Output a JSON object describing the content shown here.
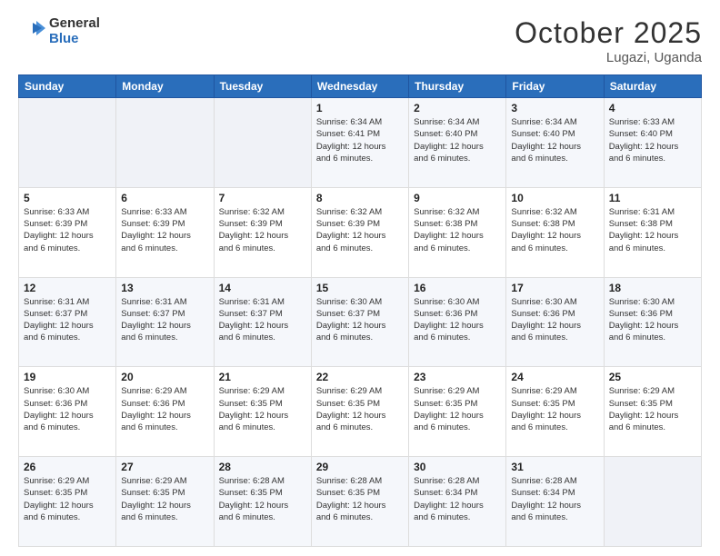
{
  "logo": {
    "line1": "General",
    "line2": "Blue"
  },
  "header": {
    "month": "October 2025",
    "location": "Lugazi, Uganda"
  },
  "weekdays": [
    "Sunday",
    "Monday",
    "Tuesday",
    "Wednesday",
    "Thursday",
    "Friday",
    "Saturday"
  ],
  "weeks": [
    [
      {
        "day": "",
        "info": ""
      },
      {
        "day": "",
        "info": ""
      },
      {
        "day": "",
        "info": ""
      },
      {
        "day": "1",
        "info": "Sunrise: 6:34 AM\nSunset: 6:41 PM\nDaylight: 12 hours\nand 6 minutes."
      },
      {
        "day": "2",
        "info": "Sunrise: 6:34 AM\nSunset: 6:40 PM\nDaylight: 12 hours\nand 6 minutes."
      },
      {
        "day": "3",
        "info": "Sunrise: 6:34 AM\nSunset: 6:40 PM\nDaylight: 12 hours\nand 6 minutes."
      },
      {
        "day": "4",
        "info": "Sunrise: 6:33 AM\nSunset: 6:40 PM\nDaylight: 12 hours\nand 6 minutes."
      }
    ],
    [
      {
        "day": "5",
        "info": "Sunrise: 6:33 AM\nSunset: 6:39 PM\nDaylight: 12 hours\nand 6 minutes."
      },
      {
        "day": "6",
        "info": "Sunrise: 6:33 AM\nSunset: 6:39 PM\nDaylight: 12 hours\nand 6 minutes."
      },
      {
        "day": "7",
        "info": "Sunrise: 6:32 AM\nSunset: 6:39 PM\nDaylight: 12 hours\nand 6 minutes."
      },
      {
        "day": "8",
        "info": "Sunrise: 6:32 AM\nSunset: 6:39 PM\nDaylight: 12 hours\nand 6 minutes."
      },
      {
        "day": "9",
        "info": "Sunrise: 6:32 AM\nSunset: 6:38 PM\nDaylight: 12 hours\nand 6 minutes."
      },
      {
        "day": "10",
        "info": "Sunrise: 6:32 AM\nSunset: 6:38 PM\nDaylight: 12 hours\nand 6 minutes."
      },
      {
        "day": "11",
        "info": "Sunrise: 6:31 AM\nSunset: 6:38 PM\nDaylight: 12 hours\nand 6 minutes."
      }
    ],
    [
      {
        "day": "12",
        "info": "Sunrise: 6:31 AM\nSunset: 6:37 PM\nDaylight: 12 hours\nand 6 minutes."
      },
      {
        "day": "13",
        "info": "Sunrise: 6:31 AM\nSunset: 6:37 PM\nDaylight: 12 hours\nand 6 minutes."
      },
      {
        "day": "14",
        "info": "Sunrise: 6:31 AM\nSunset: 6:37 PM\nDaylight: 12 hours\nand 6 minutes."
      },
      {
        "day": "15",
        "info": "Sunrise: 6:30 AM\nSunset: 6:37 PM\nDaylight: 12 hours\nand 6 minutes."
      },
      {
        "day": "16",
        "info": "Sunrise: 6:30 AM\nSunset: 6:36 PM\nDaylight: 12 hours\nand 6 minutes."
      },
      {
        "day": "17",
        "info": "Sunrise: 6:30 AM\nSunset: 6:36 PM\nDaylight: 12 hours\nand 6 minutes."
      },
      {
        "day": "18",
        "info": "Sunrise: 6:30 AM\nSunset: 6:36 PM\nDaylight: 12 hours\nand 6 minutes."
      }
    ],
    [
      {
        "day": "19",
        "info": "Sunrise: 6:30 AM\nSunset: 6:36 PM\nDaylight: 12 hours\nand 6 minutes."
      },
      {
        "day": "20",
        "info": "Sunrise: 6:29 AM\nSunset: 6:36 PM\nDaylight: 12 hours\nand 6 minutes."
      },
      {
        "day": "21",
        "info": "Sunrise: 6:29 AM\nSunset: 6:35 PM\nDaylight: 12 hours\nand 6 minutes."
      },
      {
        "day": "22",
        "info": "Sunrise: 6:29 AM\nSunset: 6:35 PM\nDaylight: 12 hours\nand 6 minutes."
      },
      {
        "day": "23",
        "info": "Sunrise: 6:29 AM\nSunset: 6:35 PM\nDaylight: 12 hours\nand 6 minutes."
      },
      {
        "day": "24",
        "info": "Sunrise: 6:29 AM\nSunset: 6:35 PM\nDaylight: 12 hours\nand 6 minutes."
      },
      {
        "day": "25",
        "info": "Sunrise: 6:29 AM\nSunset: 6:35 PM\nDaylight: 12 hours\nand 6 minutes."
      }
    ],
    [
      {
        "day": "26",
        "info": "Sunrise: 6:29 AM\nSunset: 6:35 PM\nDaylight: 12 hours\nand 6 minutes."
      },
      {
        "day": "27",
        "info": "Sunrise: 6:29 AM\nSunset: 6:35 PM\nDaylight: 12 hours\nand 6 minutes."
      },
      {
        "day": "28",
        "info": "Sunrise: 6:28 AM\nSunset: 6:35 PM\nDaylight: 12 hours\nand 6 minutes."
      },
      {
        "day": "29",
        "info": "Sunrise: 6:28 AM\nSunset: 6:35 PM\nDaylight: 12 hours\nand 6 minutes."
      },
      {
        "day": "30",
        "info": "Sunrise: 6:28 AM\nSunset: 6:34 PM\nDaylight: 12 hours\nand 6 minutes."
      },
      {
        "day": "31",
        "info": "Sunrise: 6:28 AM\nSunset: 6:34 PM\nDaylight: 12 hours\nand 6 minutes."
      },
      {
        "day": "",
        "info": ""
      }
    ]
  ]
}
